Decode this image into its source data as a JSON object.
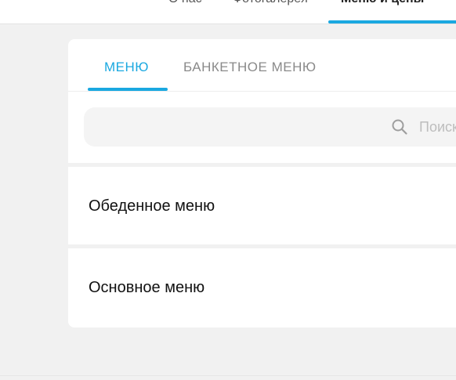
{
  "topnav": {
    "items": [
      {
        "label": "О нас",
        "active": false
      },
      {
        "label": "Фотогалерея",
        "active": false
      },
      {
        "label": "Меню и цены",
        "active": true
      }
    ]
  },
  "tabs": [
    {
      "label": "МЕНЮ",
      "active": true
    },
    {
      "label": "БАНКЕТНОЕ МЕНЮ",
      "active": false
    }
  ],
  "search": {
    "placeholder": "Поиск",
    "value": ""
  },
  "menu": {
    "items": [
      {
        "label": "Обеденное меню"
      },
      {
        "label": "Основное меню"
      }
    ]
  },
  "colors": {
    "accent": "#1aa8e0",
    "background": "#f1f1f1",
    "card": "#ffffff"
  },
  "icons": {
    "search": "search-icon"
  }
}
